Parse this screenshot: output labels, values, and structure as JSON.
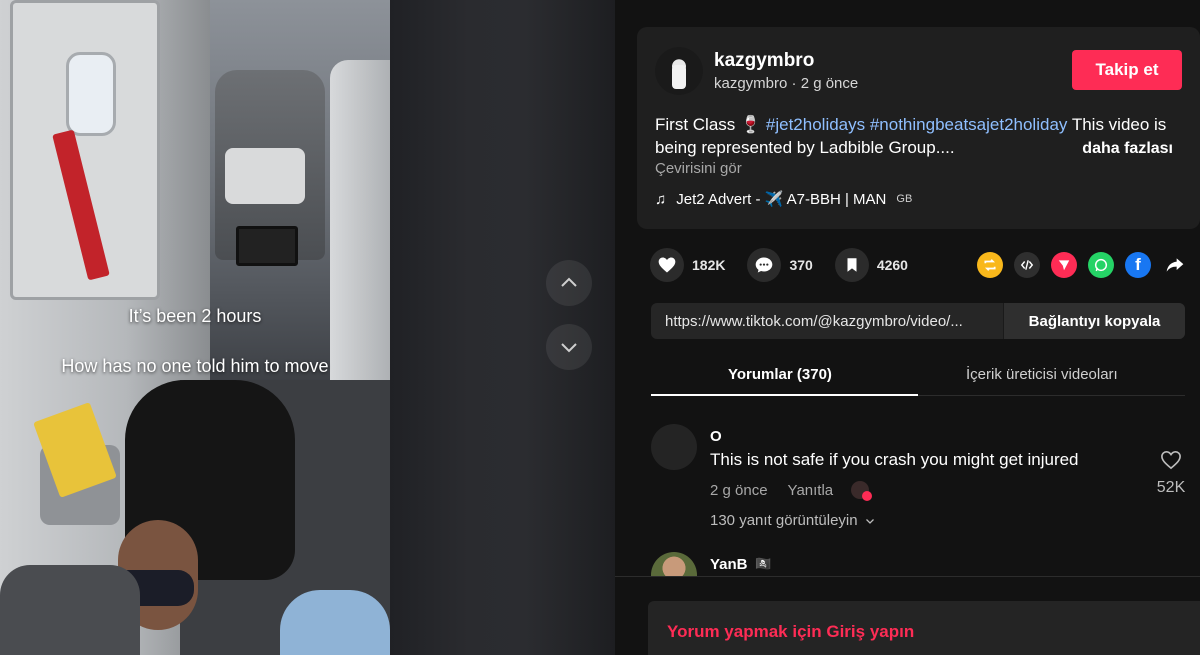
{
  "video": {
    "caption_line1": "It’s been 2 hours",
    "caption_line2": "How has no one told him to move"
  },
  "author": {
    "username": "kazgymbro",
    "subtitle": "kazgymbro · 2 g önce",
    "follow_label": "Takip et"
  },
  "description": {
    "prefix": "First Class 🍷 ",
    "hashtags": "#jet2holidays #nothingbeatsajet2holiday",
    "text_after": " This video is being represented by Ladbible Group....",
    "more_label": "daha fazlası",
    "translate_label": "Çevirisini gör"
  },
  "music": {
    "icon": "music-note-icon",
    "title": "Jet2 Advert - ✈️ A7-BBH | MAN",
    "suffix": "GB"
  },
  "stats": {
    "likes": "182K",
    "comments": "370",
    "saves": "4260"
  },
  "share_icons": [
    {
      "name": "repost-icon",
      "color": "#f9b81b"
    },
    {
      "name": "embed-icon",
      "color": "#2f2f2f"
    },
    {
      "name": "send-icon",
      "color": "#fe2c55"
    },
    {
      "name": "whatsapp-icon",
      "color": "#25d366"
    },
    {
      "name": "facebook-icon",
      "color": "#1877f2"
    },
    {
      "name": "share-arrow-icon",
      "color": "transparent"
    }
  ],
  "link": {
    "url": "https://www.tiktok.com/@kazgymbro/video/...",
    "copy_label": "Bağlantıyı kopyala"
  },
  "tabs": {
    "comments": "Yorumlar (370)",
    "creator_videos": "İçerik üreticisi videoları"
  },
  "comments": [
    {
      "name": "O",
      "text": "This is not safe if you crash you might get injured",
      "time": "2 g önce",
      "reply_label": "Yanıtla",
      "likes": "52K",
      "view_replies": "130 yanıt görüntüleyin"
    },
    {
      "name": "YanB",
      "flag": "🏴‍☠️"
    }
  ],
  "login_prompt": "Yorum yapmak için Giriş yapın",
  "colors": {
    "accent": "#fe2c55",
    "hashtag": "#8fbfff",
    "background": "#121212",
    "card": "#1f1f1f"
  }
}
